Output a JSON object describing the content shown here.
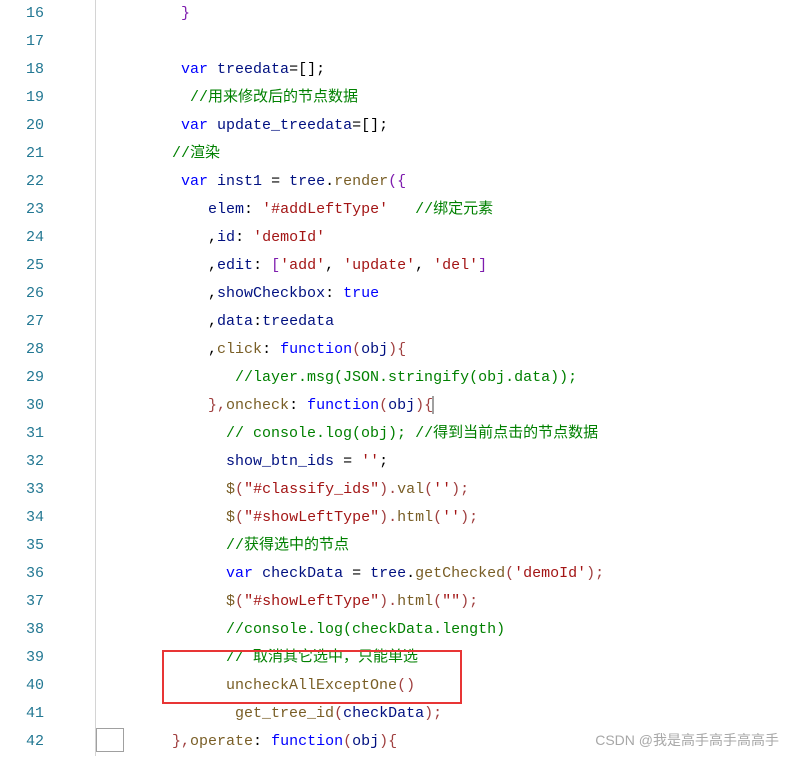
{
  "gutter": [
    "16",
    "17",
    "18",
    "19",
    "20",
    "21",
    "22",
    "23",
    "24",
    "25",
    "26",
    "27",
    "28",
    "29",
    "30",
    "31",
    "32",
    "33",
    "34",
    "35",
    "36",
    "37",
    "38",
    "39",
    "40",
    "41",
    "42"
  ],
  "lines": {
    "l16": {
      "indent": "         ",
      "brace": "}"
    },
    "l18": {
      "indent": "         ",
      "kw": "var",
      "sp": " ",
      "name": "treedata",
      "op": "=[]",
      "semi": ";"
    },
    "l19": {
      "indent": "          ",
      "com": "//用来修改后的节点数据"
    },
    "l20": {
      "indent": "         ",
      "kw": "var",
      "sp": " ",
      "name": "update_treedata",
      "op": "=[]",
      "semi": ";"
    },
    "l21": {
      "indent": "        ",
      "com": "//渲染"
    },
    "l22": {
      "indent": "         ",
      "kw": "var",
      "sp": " ",
      "name": "inst1",
      "sp2": " = ",
      "obj": "tree",
      "dot": ".",
      "fn": "render",
      "paren": "({"
    },
    "l23": {
      "indent": "            ",
      "prop": "elem",
      "col": ": ",
      "str": "'#addLeftType'",
      "sp": "   ",
      "com": "//绑定元素"
    },
    "l24": {
      "indent": "            ",
      "comma": ",",
      "prop": "id",
      "col": ": ",
      "str": "'demoId'"
    },
    "l25": {
      "indent": "            ",
      "comma": ",",
      "prop": "edit",
      "col": ": ",
      "lb": "[",
      "s1": "'add'",
      "c1": ", ",
      "s2": "'update'",
      "c2": ", ",
      "s3": "'del'",
      "rb": "]"
    },
    "l26": {
      "indent": "            ",
      "comma": ",",
      "prop": "showCheckbox",
      "col": ": ",
      "val": "true"
    },
    "l27": {
      "indent": "            ",
      "comma": ",",
      "prop": "data",
      "col": ":",
      "val": "treedata"
    },
    "l28": {
      "indent": "            ",
      "comma": ",",
      "prop": "click",
      "col": ": ",
      "kw": "function",
      "paren": "(",
      "arg": "obj",
      "brace": "){"
    },
    "l29": {
      "indent": "               ",
      "com": "//layer.msg(JSON.stringify(obj.data));"
    },
    "l30": {
      "indent": "            ",
      "close": "},",
      "prop": "oncheck",
      "col": ": ",
      "kw": "function",
      "paren": "(",
      "arg": "obj",
      "brace": "){"
    },
    "l31": {
      "indent": "              ",
      "com1": "// console.log(obj); ",
      "com2": "//得到当前点击的节点数据"
    },
    "l32": {
      "indent": "              ",
      "name": "show_btn_ids",
      "sp": " = ",
      "str": "''",
      "semi": ";"
    },
    "l33": {
      "indent": "              ",
      "fn": "$",
      "paren": "(",
      "str": "\"#classify_ids\"",
      "rp": ").",
      "fn2": "val",
      "lp2": "(",
      "str2": "''",
      "rp2": ");"
    },
    "l34": {
      "indent": "              ",
      "fn": "$",
      "paren": "(",
      "str": "\"#showLeftType\"",
      "rp": ").",
      "fn2": "html",
      "lp2": "(",
      "str2": "''",
      "rp2": ");"
    },
    "l35": {
      "indent": "              ",
      "com": "//获得选中的节点"
    },
    "l36": {
      "indent": "              ",
      "kw": "var",
      "sp": " ",
      "name": "checkData",
      "sp2": " = ",
      "obj": "tree",
      "dot": ".",
      "fn": "getChecked",
      "lp": "(",
      "str": "'demoId'",
      "rp": ");"
    },
    "l37": {
      "indent": "              ",
      "fn": "$",
      "paren": "(",
      "str": "\"#showLeftType\"",
      "rp": ").",
      "fn2": "html",
      "lp2": "(",
      "str2": "\"\"",
      "rp2": ");"
    },
    "l38": {
      "indent": "              ",
      "com": "//console.log(checkData.length)"
    },
    "l39": {
      "indent": "              ",
      "com": "// 取消其它选中，只能单选"
    },
    "l40": {
      "indent": "              ",
      "fn": "uncheckAllExceptOne",
      "paren": "()"
    },
    "l41": {
      "indent": "               ",
      "fn": "get_tree_id",
      "lp": "(",
      "arg": "checkData",
      "rp": ");"
    },
    "l42": {
      "indent": "        ",
      "close": "},",
      "prop": "operate",
      "col": ": ",
      "kw": "function",
      "paren": "(",
      "arg": "obj",
      "brace": "){"
    }
  },
  "watermark": "CSDN @我是高手高手高高手"
}
